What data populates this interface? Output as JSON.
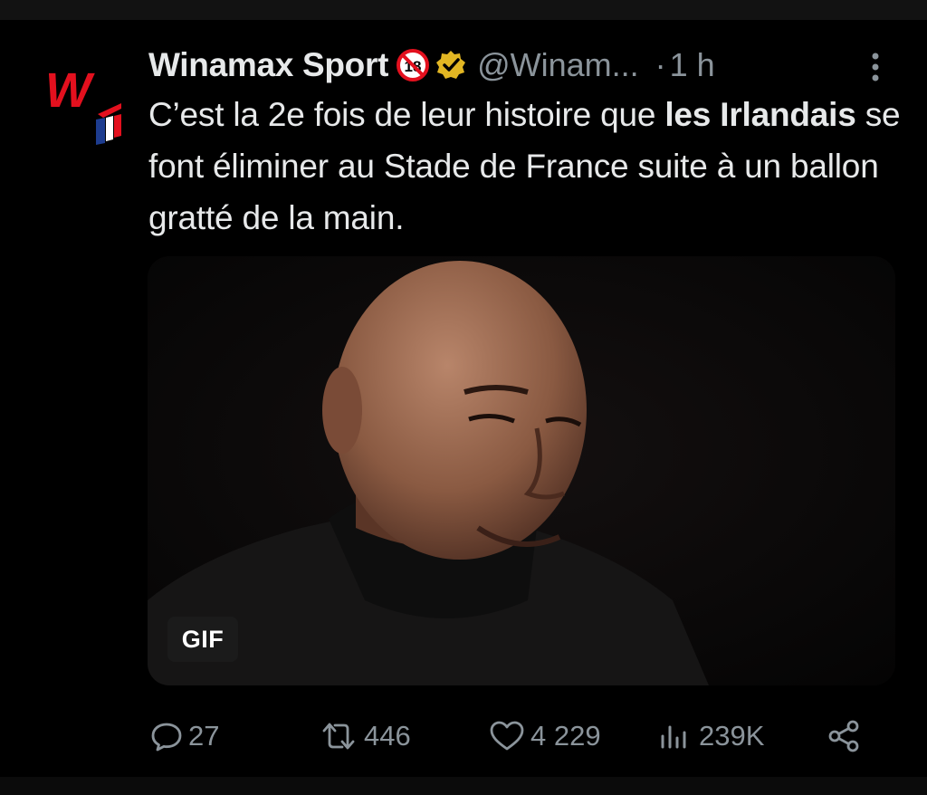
{
  "tweet": {
    "author": {
      "name": "Winamax Sport",
      "handle": "@Winam...",
      "badge_18": "18",
      "verified_color": "#e2b623"
    },
    "separator": "·",
    "time": "1 h",
    "text": {
      "part1": "C’est la 2e fois de leur histoire que ",
      "bold1": "les Irlandais",
      "part2": " se font éliminer au Stade de France suite à un ballon gratté de la main."
    },
    "media": {
      "type_badge": "GIF"
    },
    "actions": {
      "replies": "27",
      "reposts": "446",
      "likes": "4 229",
      "views": "239K"
    }
  },
  "icons": [
    "winamax-logo-icon",
    "age-18-icon",
    "verified-icon",
    "more-icon",
    "reply-icon",
    "repost-icon",
    "like-icon",
    "views-icon",
    "share-icon"
  ],
  "colors": {
    "background": "#000000",
    "text": "#e7e9ea",
    "secondary": "#8b949b",
    "brand_red": "#e3101e"
  }
}
